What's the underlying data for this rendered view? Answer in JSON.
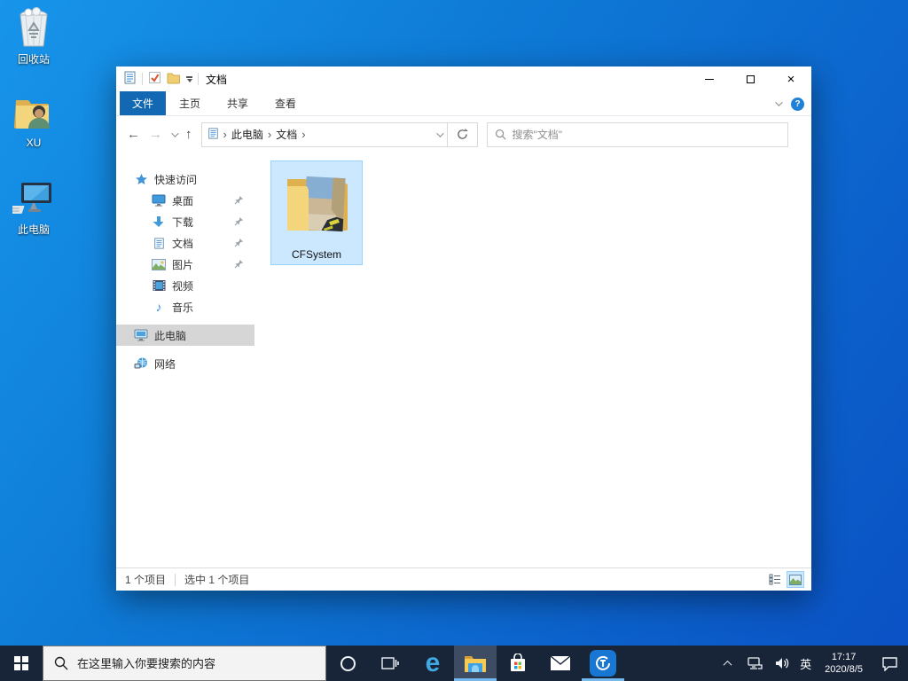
{
  "desktop": {
    "icons": [
      {
        "label": "回收站"
      },
      {
        "label": "XU"
      },
      {
        "label": "此电脑"
      }
    ]
  },
  "explorer": {
    "title": "文档",
    "tabs": [
      {
        "label": "文件"
      },
      {
        "label": "主页"
      },
      {
        "label": "共享"
      },
      {
        "label": "查看"
      }
    ],
    "breadcrumb": {
      "root": "此电脑",
      "current": "文档"
    },
    "search_placeholder": "搜索\"文档\"",
    "sidebar": {
      "items": [
        {
          "label": "快速访问"
        },
        {
          "label": "桌面"
        },
        {
          "label": "下载"
        },
        {
          "label": "文档"
        },
        {
          "label": "图片"
        },
        {
          "label": "视频"
        },
        {
          "label": "音乐"
        },
        {
          "label": "此电脑"
        },
        {
          "label": "网络"
        }
      ]
    },
    "files": [
      {
        "name": "CFSystem"
      }
    ],
    "status": {
      "count": "1 个项目",
      "selected": "选中 1 个项目"
    }
  },
  "taskbar": {
    "search_placeholder": "在这里输入你要搜索的内容",
    "tray": {
      "ime": "英",
      "time": "17:17",
      "date": "2020/8/5"
    }
  },
  "colors": {
    "accent": "#0078d7",
    "file_tab_blue": "#1268b3",
    "selection_fill": "#cce8ff",
    "selection_border": "#99d1ff",
    "taskbar_bg": "#182438",
    "desktop_gradient_top": "#1795ea",
    "desktop_gradient_bottom": "#0a50c4"
  }
}
